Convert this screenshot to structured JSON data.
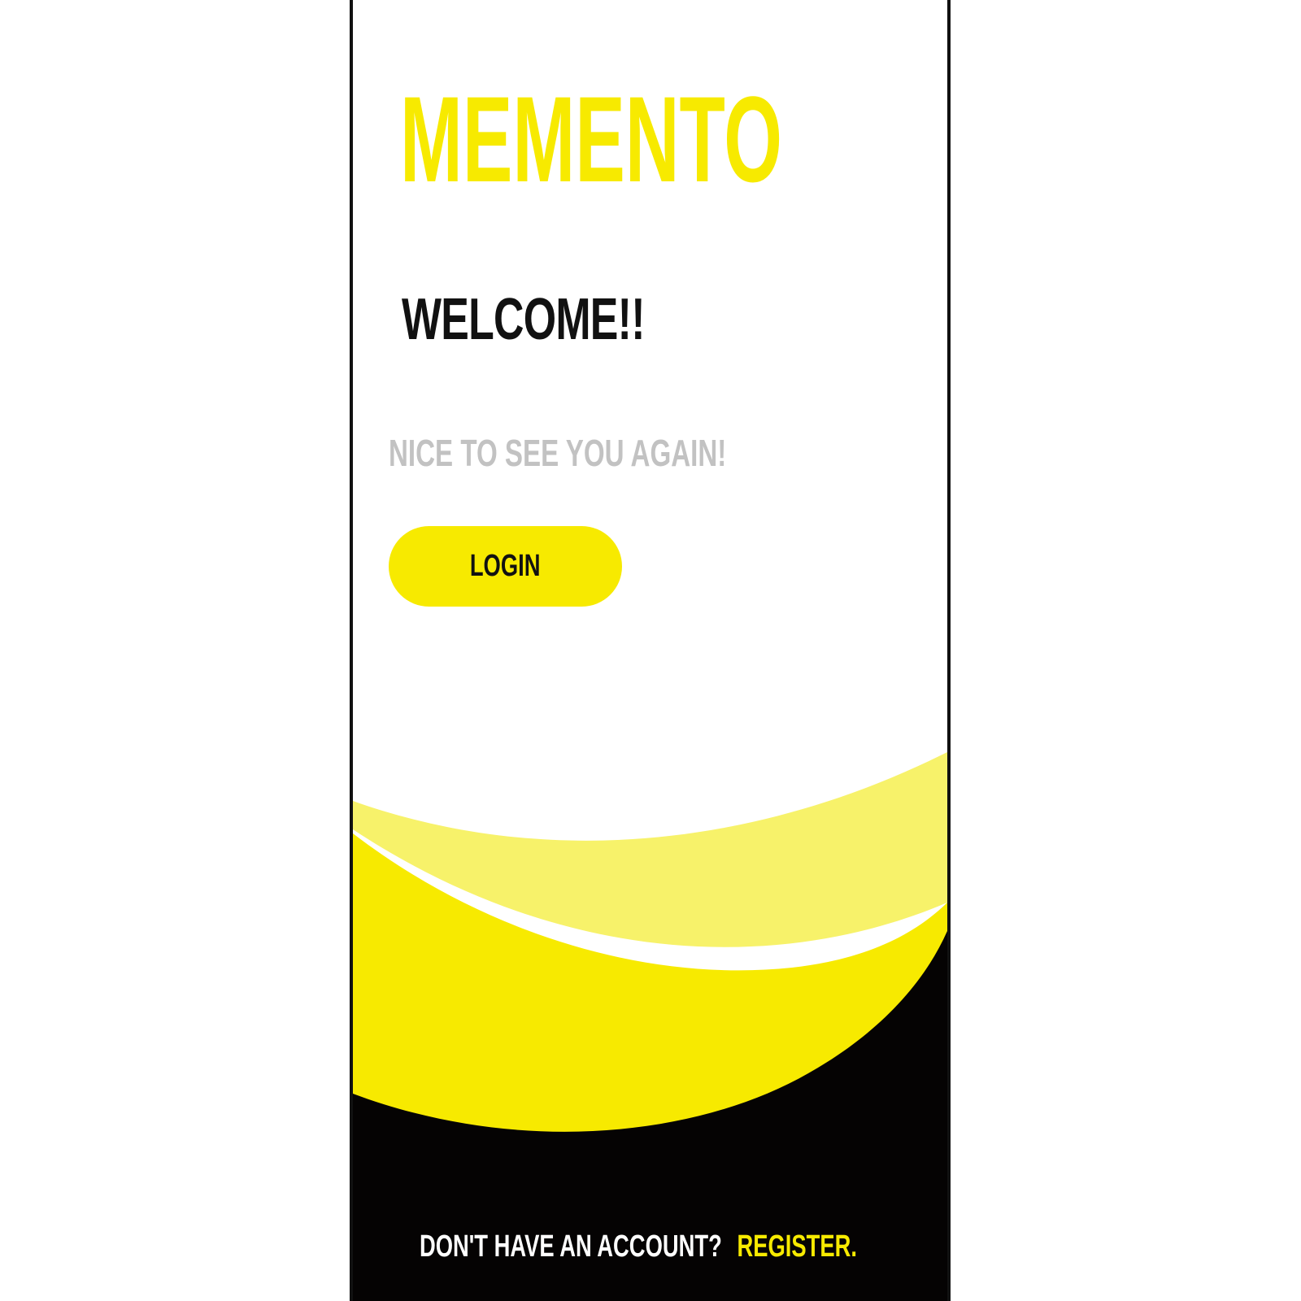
{
  "app": {
    "logo_text": "MEMENTO"
  },
  "welcome": {
    "title": "WELCOME!!",
    "subtitle": "NICE TO SEE YOU AGAIN!"
  },
  "actions": {
    "login_label": "LOGIN"
  },
  "footer": {
    "question": "DON'T HAVE AN ACCOUNT?",
    "register_label": "REGISTER."
  },
  "colors": {
    "accent": "#f7ea00",
    "accent_light": "#f7f26a",
    "dark": "#050303",
    "subtle_text": "#c2c2c2"
  }
}
